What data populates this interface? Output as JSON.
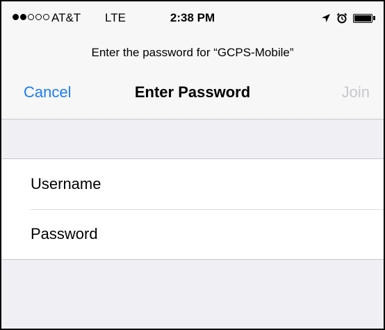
{
  "status_bar": {
    "carrier": "AT&T",
    "network": "LTE",
    "time": "2:38 PM",
    "signal": {
      "filled": 2,
      "total": 5
    },
    "icons": [
      "location-arrow-icon",
      "alarm-clock-icon",
      "battery-icon"
    ],
    "battery_level": 1.0
  },
  "prompt": "Enter the password for “GCPS-Mobile”",
  "nav": {
    "cancel_label": "Cancel",
    "title": "Enter Password",
    "join_label": "Join"
  },
  "form": {
    "username": {
      "placeholder": "Username",
      "value": ""
    },
    "password": {
      "placeholder": "Password",
      "value": ""
    }
  },
  "colors": {
    "accent": "#1a7cf4",
    "disabled": "#c7c7cc",
    "background": "#efeff4"
  }
}
